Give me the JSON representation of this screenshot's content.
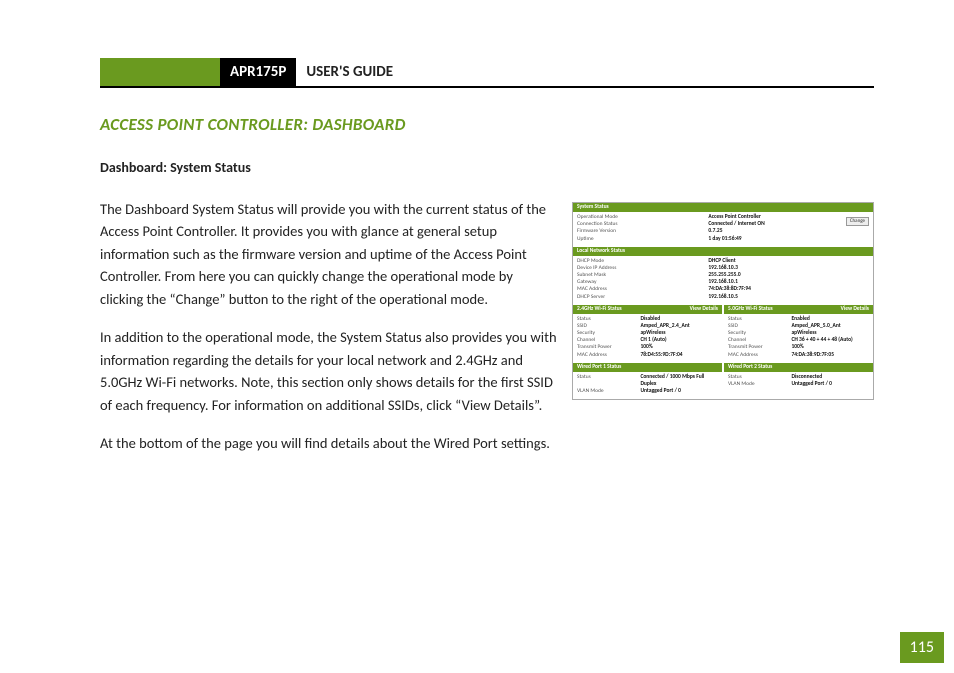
{
  "header": {
    "model": "APR175P",
    "guide": "USER'S GUIDE"
  },
  "section_title": "ACCESS POINT CONTROLLER: DASHBOARD",
  "sub_title": "Dashboard: System Status",
  "paragraphs": {
    "p1": "The Dashboard System Status will provide you with the current status of the Access Point Controller.  It provides you with glance at general setup information such as the firmware version and uptime of the Access Point Controller.  From here you can quickly change the operational mode by clicking the “Change” button to the right of the operational mode.",
    "p2": "In addition to the operational mode, the System Status also provides you with information regarding the details for your local network and 2.4GHz and 5.0GHz Wi-Fi networks. Note, this section only shows details for the first SSID of each frequency.  For information on additional SSIDs, click “View Details”.",
    "p3": "At the bottom of the page you will find details about the Wired Port settings."
  },
  "figure": {
    "system_status": {
      "title": "System Status",
      "change_btn": "Change",
      "rows": {
        "mode_k": "Operational Mode",
        "mode_v": "Access Point Controller",
        "conn_k": "Connection Status",
        "conn_v": "Connected / Internet ON",
        "fw_k": "Firmware Version",
        "fw_v": "0.7.25",
        "up_k": "Uptime",
        "up_v": "1 day 01:56:49"
      }
    },
    "local_net": {
      "title": "Local Network Status",
      "rows": {
        "dhcp_k": "DHCP Mode",
        "dhcp_v": "DHCP Client",
        "ip_k": "Device IP Address",
        "ip_v": "192.168.10.3",
        "sub_k": "Subnet Mask",
        "sub_v": "255.255.255.0",
        "gw_k": "Gateway",
        "gw_v": "192.168.10.1",
        "mac_k": "MAC Address",
        "mac_v": "74:DA:38:8D:7F:94",
        "dsrv_k": "DHCP Server",
        "dsrv_v": "192.168.10.5"
      }
    },
    "wifi24": {
      "title": "2.4GHz Wi-Fi Status",
      "link": "View Details",
      "rows": {
        "st_k": "Status",
        "st_v": "Disabled",
        "ssid_k": "SSID",
        "ssid_v": "Amped_APR_2.4_Ant",
        "sec_k": "Security",
        "sec_v": "apWireless",
        "ch_k": "Channel",
        "ch_v": "CH 1 (Auto)",
        "tx_k": "Transmit Power",
        "tx_v": "100%",
        "mac_k": "MAC Address",
        "mac_v": "78:D4:55:9D:7F:04"
      }
    },
    "wifi50": {
      "title": "5.0GHz Wi-Fi Status",
      "link": "View Details",
      "rows": {
        "st_k": "Status",
        "st_v": "Enabled",
        "ssid_k": "SSID",
        "ssid_v": "Amped_APR_5.0_Ant",
        "sec_k": "Security",
        "sec_v": "apWireless",
        "ch_k": "Channel",
        "ch_v": "CH 36 + 40 + 44 + 48 (Auto)",
        "tx_k": "Transmit Power",
        "tx_v": "100%",
        "mac_k": "MAC Address",
        "mac_v": "74:DA:38:9D:7F:05"
      }
    },
    "port1": {
      "title": "Wired Port 1 Status",
      "rows": {
        "st_k": "Status",
        "st_v": "Connected / 1000 Mbps Full Duplex",
        "vl_k": "VLAN Mode",
        "vl_v": "Untagged Port  /  0"
      }
    },
    "port2": {
      "title": "Wired Port 2 Status",
      "rows": {
        "st_k": "Status",
        "st_v": "Disconnected",
        "vl_k": "VLAN Mode",
        "vl_v": "Untagged Port  /  0"
      }
    }
  },
  "page_number": "115"
}
